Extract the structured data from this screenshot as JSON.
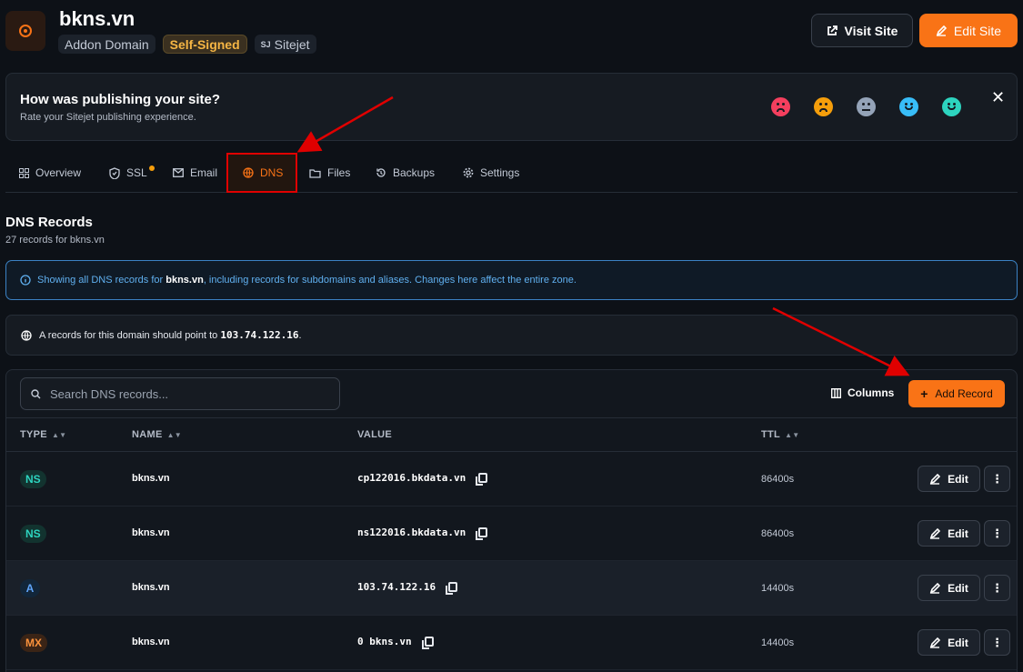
{
  "header": {
    "title": "bkns.vn",
    "badges": [
      "Addon Domain",
      "Self-Signed",
      "Sitejet"
    ],
    "sitejet_prefix": "SJ",
    "visit_label": "Visit Site",
    "edit_label": "Edit Site",
    "accent": "#f97316"
  },
  "feedback": {
    "question": "How was publishing your site?",
    "subtitle": "Rate your Sitejet publishing experience.",
    "faces": [
      "very-dissatisfied-icon",
      "dissatisfied-icon",
      "neutral-icon",
      "satisfied-icon",
      "very-satisfied-icon"
    ],
    "close": "✕"
  },
  "tabs": [
    {
      "label": "Overview",
      "icon": "grid-icon"
    },
    {
      "label": "SSL",
      "icon": "shield-icon"
    },
    {
      "label": "Email",
      "icon": "mail-icon"
    },
    {
      "label": "DNS",
      "icon": "globe-icon",
      "active": true
    },
    {
      "label": "Files",
      "icon": "folder-icon"
    },
    {
      "label": "Backups",
      "icon": "history-icon"
    },
    {
      "label": "Settings",
      "icon": "gear-icon"
    }
  ],
  "dns": {
    "title": "DNS Records",
    "count": "27 records for bkns.vn",
    "info_prefix": "Showing all DNS records for ",
    "info_domain": "bkns.vn",
    "info_suffix": ", including records for subdomains and aliases. Changes here affect the entire zone.",
    "a_prefix": "A records for this domain should point to ",
    "a_ip": "103.74.122.16",
    "a_suffix": "."
  },
  "table": {
    "search_placeholder": "Search DNS records...",
    "columns_label": "Columns",
    "add_label": "Add Record",
    "headers": {
      "type": "TYPE",
      "name": "NAME",
      "value": "VALUE",
      "ttl": "TTL"
    },
    "edit_label": "Edit",
    "more_label": "⋮",
    "rows": [
      {
        "type": "NS",
        "name": "bkns.vn",
        "value": "cp122016.bkdata.vn",
        "ttl": "86400s"
      },
      {
        "type": "NS",
        "name": "bkns.vn",
        "value": "ns122016.bkdata.vn",
        "ttl": "86400s"
      },
      {
        "type": "A",
        "name": "bkns.vn",
        "value": "103.74.122.16",
        "ttl": "14400s"
      },
      {
        "type": "MX",
        "name": "bkns.vn",
        "value": "0 bkns.vn",
        "ttl": "14400s"
      }
    ]
  }
}
